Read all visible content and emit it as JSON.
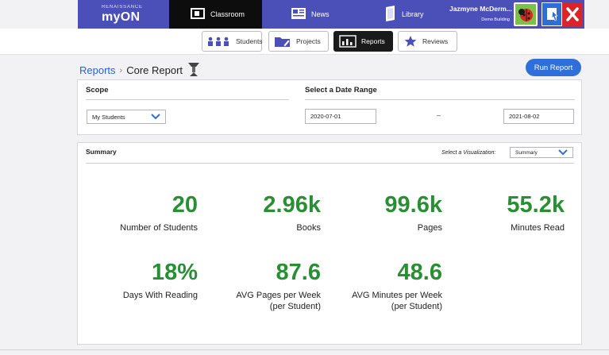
{
  "brand": {
    "small": "RENAISSANCE",
    "name": "myON"
  },
  "nav": {
    "classroom": "Classroom",
    "news": "News",
    "library": "Library"
  },
  "user": {
    "name": "Jazmyne McDerm...",
    "school": "Demo Building"
  },
  "subnav": {
    "students": "Students",
    "projects": "Projects",
    "reports": "Reports",
    "reviews": "Reviews"
  },
  "breadcrumb": {
    "parent": "Reports",
    "separator": "›",
    "current": "Core Report"
  },
  "run_report_label": "Run Report",
  "scope": {
    "title": "Scope",
    "selected": "My Students"
  },
  "date_range": {
    "title": "Select a Date Range",
    "start": "2020-07-01",
    "separator": "–",
    "end": "2021-08-02"
  },
  "summary": {
    "title": "Summary",
    "viz_label": "Select a Visualization:",
    "viz_selected": "Summary",
    "metrics": [
      {
        "value": "20",
        "label": "Number of Students"
      },
      {
        "value": "2.96k",
        "label": "Books"
      },
      {
        "value": "99.6k",
        "label": "Pages"
      },
      {
        "value": "55.2k",
        "label": "Minutes Read"
      },
      {
        "value": "18%",
        "label": "Days With Reading"
      },
      {
        "value": "87.6",
        "label": "AVG Pages per Week",
        "label2": "(per Student)"
      },
      {
        "value": "48.6",
        "label": "AVG Minutes per Week",
        "label2": "(per Student)"
      }
    ]
  },
  "colors": {
    "topbar": "#4a50b8",
    "metric_green": "#2a8f34",
    "link_blue": "#2b62c4",
    "run_button": "#2f6fd9"
  },
  "icons": [
    "classroom-icon",
    "news-icon",
    "library-icon",
    "help-icon",
    "close-icon",
    "students-icon",
    "projects-icon",
    "reports-icon",
    "reviews-icon",
    "core-report-icon",
    "chevron-down-icon"
  ]
}
